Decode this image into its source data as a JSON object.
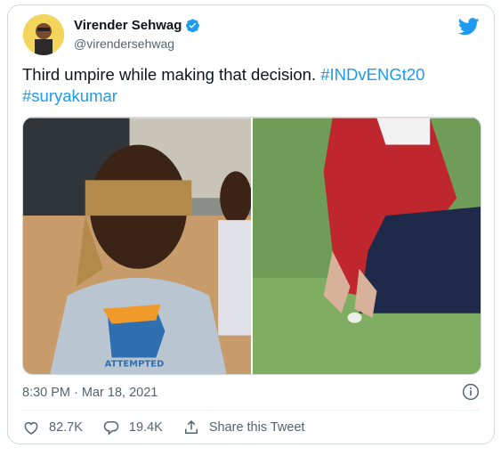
{
  "author": {
    "name": "Virender Sehwag",
    "handle": "@virendersehwag"
  },
  "tweet": {
    "text": "Third umpire while making that decision. ",
    "hashtag1": "#INDvENGt20",
    "hashtag2": "#suryakumar",
    "timestamp": "8:30 PM · Mar 18, 2021"
  },
  "media": {
    "left_shirt_text": "ATTEMPTED"
  },
  "actions": {
    "likes": "82.7K",
    "replies": "19.4K",
    "share_label": "Share this Tweet"
  },
  "colors": {
    "accent": "#1d9bf0",
    "secondary_text": "#536471"
  },
  "icons": [
    "twitter-bird-icon",
    "verified-badge-icon",
    "info-icon",
    "heart-icon",
    "reply-icon",
    "share-icon"
  ]
}
